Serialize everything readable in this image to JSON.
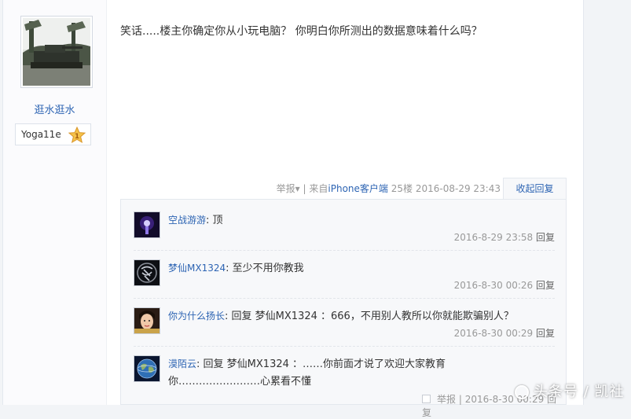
{
  "post": {
    "author": {
      "name": "逛水逛水",
      "badge_name": "Yoga11e",
      "badge_level": "1",
      "avatar_icon": "tank-photo-avatar"
    },
    "content": "笑话.....楼主你确定你从小玩电脑？ 你明白你所测出的数据意味着什么吗？",
    "meta": {
      "report": "举报",
      "from_prefix": "来自",
      "client": "iPhone客户端",
      "floor": "25楼",
      "time": "2016-08-29 23:43",
      "separator": "|"
    },
    "fold_reply": "收起回复"
  },
  "replies": [
    {
      "user": "空战游游",
      "colon": ":",
      "text": "顶",
      "time": "2016-8-29 23:58",
      "reply": "回复",
      "avatar_icon": "purple-light-avatar"
    },
    {
      "user": "梦仙MX1324",
      "colon": ":",
      "text": "至少不用你教我",
      "time": "2016-8-30 00:26",
      "reply": "回复",
      "avatar_icon": "dream-glyph-avatar"
    },
    {
      "user": "你为什么扬长",
      "colon": ":",
      "text": "回复 梦仙MX1324 ：666，不用别人教所以你就能欺骗别人？",
      "time": "2016-8-30 00:29",
      "reply": "回复",
      "avatar_icon": "girl-photo-avatar"
    },
    {
      "user": "漠陌云",
      "colon": ":",
      "text": "回复 梦仙MX1324 ：……你前面才说了欢迎大家教育",
      "text2": "你……………………心累看不懂",
      "report": "举报",
      "time": "2016-8-30 00:29",
      "reply": "回复",
      "avatar_icon": "globe-avatar"
    }
  ],
  "watermark": "头条号 / 凯社"
}
